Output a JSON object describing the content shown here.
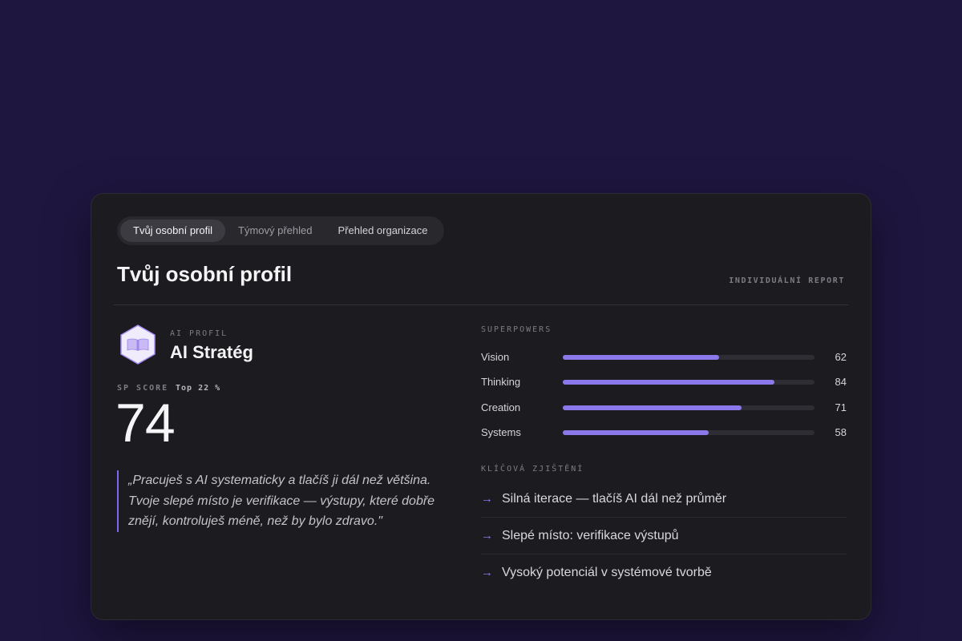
{
  "tabs": [
    {
      "label": "Tvůj osobní profil",
      "active": true
    },
    {
      "label": "Týmový přehled",
      "active": false
    },
    {
      "label": "Přehled organizace",
      "active": false
    }
  ],
  "page_title": "Tvůj osobní profil",
  "report_label": "INDIVIDUÁLNÍ REPORT",
  "profile": {
    "kicker": "AI PROFIL",
    "name": "AI Stratég",
    "icon": "book-hexagon-icon"
  },
  "score": {
    "label": "SP SCORE",
    "rank": "Top 22 %",
    "value": "74"
  },
  "quote": "„Pracuješ s AI systematicky a tlačíš ji dál než většina. Tvoje slepé místo je verifikace — výstupy, které dobře znějí, kontroluješ méně, než by bylo zdravo.\"",
  "superpowers": {
    "label": "SUPERPOWERS",
    "items": [
      {
        "name": "Vision",
        "value": 62
      },
      {
        "name": "Thinking",
        "value": 84
      },
      {
        "name": "Creation",
        "value": 71
      },
      {
        "name": "Systems",
        "value": 58
      }
    ],
    "max": 100
  },
  "key_findings": {
    "label": "KLÍČOVÁ ZJIŠTĚNÍ",
    "items": [
      {
        "arrow": "→",
        "text": "Silná iterace — tlačíš AI dál než průměr"
      },
      {
        "arrow": "→",
        "text": "Slepé místo: verifikace výstupů"
      },
      {
        "arrow": "→",
        "text": "Vysoký potenciál v systémové tvorbě"
      }
    ]
  },
  "colors": {
    "background": "#1f1640",
    "card": "#1c1b1f",
    "accent": "#8b79ec"
  }
}
